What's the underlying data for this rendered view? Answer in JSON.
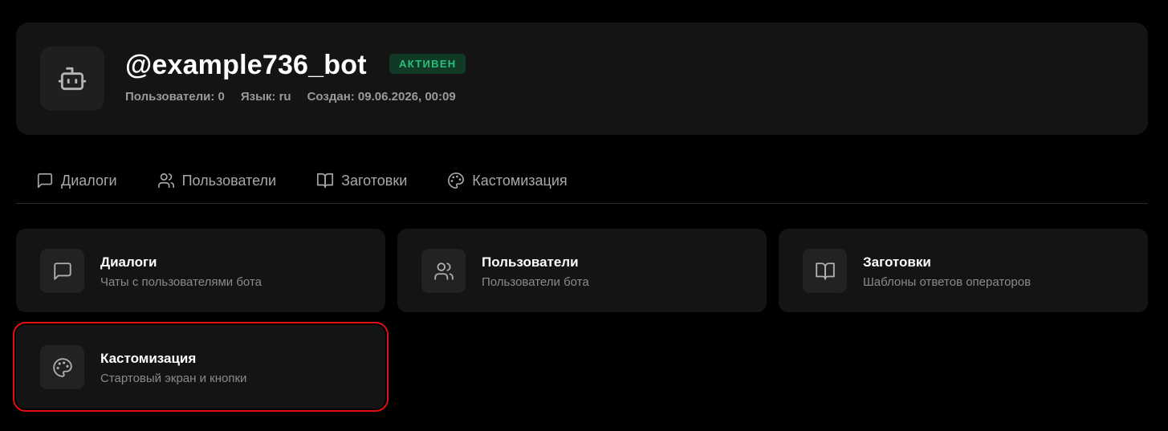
{
  "bot": {
    "username": "@example736_bot",
    "status": "АКТИВЕН",
    "meta": {
      "users": "Пользователи: 0",
      "language": "Язык: ru",
      "created": "Создан: 09.06.2026, 00:09"
    },
    "avatar_icon": "bot-icon"
  },
  "tabs": [
    {
      "label": "Диалоги",
      "icon": "message-square-icon"
    },
    {
      "label": "Пользователи",
      "icon": "users-icon"
    },
    {
      "label": "Заготовки",
      "icon": "book-open-icon"
    },
    {
      "label": "Кастомизация",
      "icon": "palette-icon"
    }
  ],
  "sections": [
    {
      "title": "Диалоги",
      "description": "Чаты с пользователями бота",
      "icon": "message-square-icon"
    },
    {
      "title": "Пользователи",
      "description": "Пользователи бота",
      "icon": "users-icon"
    },
    {
      "title": "Заготовки",
      "description": "Шаблоны ответов операторов",
      "icon": "book-open-icon"
    },
    {
      "title": "Кастомизация",
      "description": "Стартовый экран и кнопки",
      "icon": "palette-icon"
    }
  ],
  "colors": {
    "background": "#000000",
    "card": "#141414",
    "status_text": "#27c07a",
    "status_bg": "#103a26",
    "highlight": "#e01010"
  }
}
